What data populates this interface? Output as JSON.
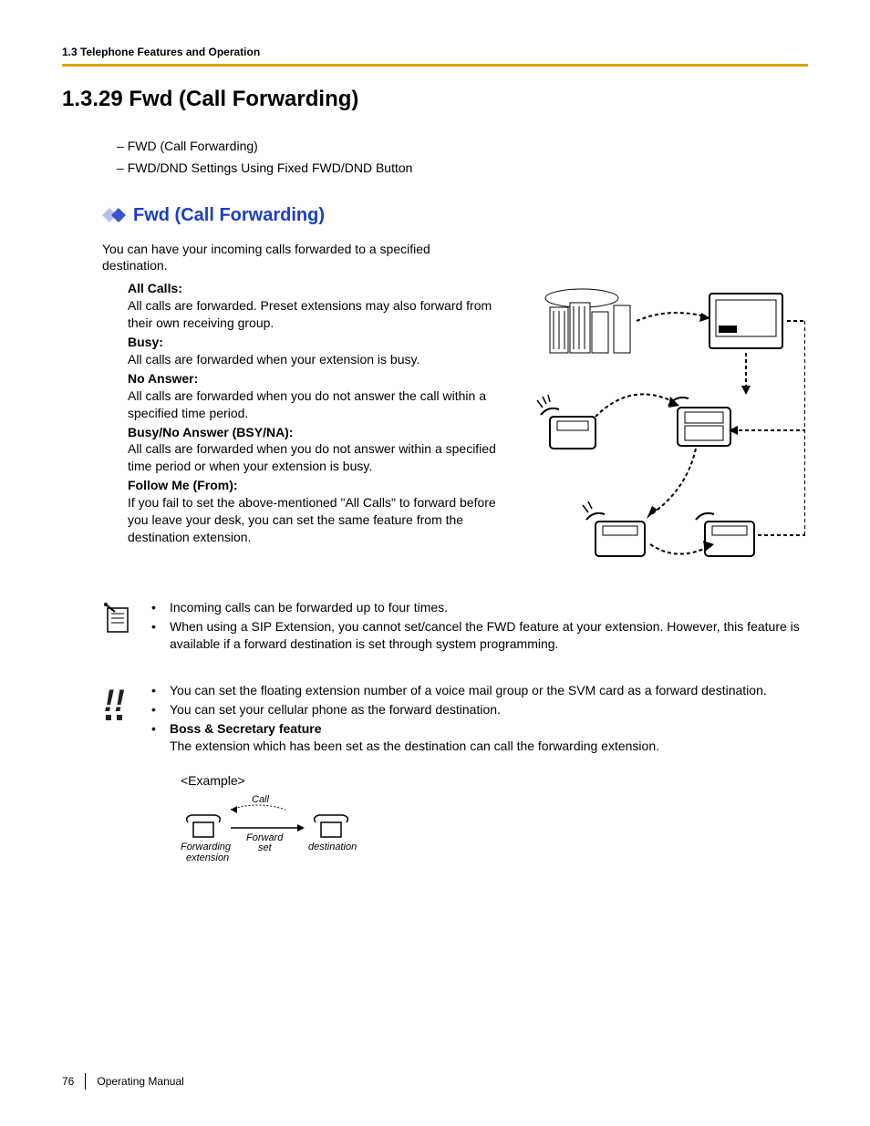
{
  "header": {
    "breadcrumb": "1.3 Telephone Features and Operation"
  },
  "title": "1.3.29  Fwd (Call Forwarding)",
  "toc": [
    "FWD (Call Forwarding)",
    "FWD/DND Settings Using Fixed FWD/DND Button"
  ],
  "subheading": "Fwd (Call Forwarding)",
  "intro": "You can have your incoming calls forwarded to a specified destination.",
  "definitions": [
    {
      "title": "All Calls:",
      "body": "All calls are forwarded. Preset extensions may also forward from their own receiving group."
    },
    {
      "title": "Busy:",
      "body": "All calls are forwarded when your extension is busy."
    },
    {
      "title": "No Answer:",
      "body": "All calls are forwarded when you do not answer the call within a specified time period."
    },
    {
      "title": "Busy/No Answer (BSY/NA):",
      "body": "All calls are forwarded when you do not answer within a specified time period or when your extension is busy."
    },
    {
      "title": "Follow Me (From):",
      "body": "If you fail to set the above-mentioned \"All Calls\" to forward before you leave your desk, you can set the same feature from the destination extension."
    }
  ],
  "notes1": [
    "Incoming calls can be forwarded up to four times.",
    "When using a SIP Extension, you cannot set/cancel the FWD feature at your extension. However, this feature is available if a forward destination is set through system programming."
  ],
  "notes2": [
    "You can set the floating extension number of a voice mail group or the SVM card as a forward destination.",
    "You can set your cellular phone as the forward destination."
  ],
  "boss": {
    "title": "Boss & Secretary feature",
    "body": "The extension which has been set as the destination can call the forwarding extension."
  },
  "example_label": "<Example>",
  "example": {
    "call": "Call",
    "forward_set": "Forward set",
    "forwarding_ext": "Forwarding extension",
    "destination": "destination"
  },
  "footer": {
    "page": "76",
    "manual": "Operating Manual"
  }
}
